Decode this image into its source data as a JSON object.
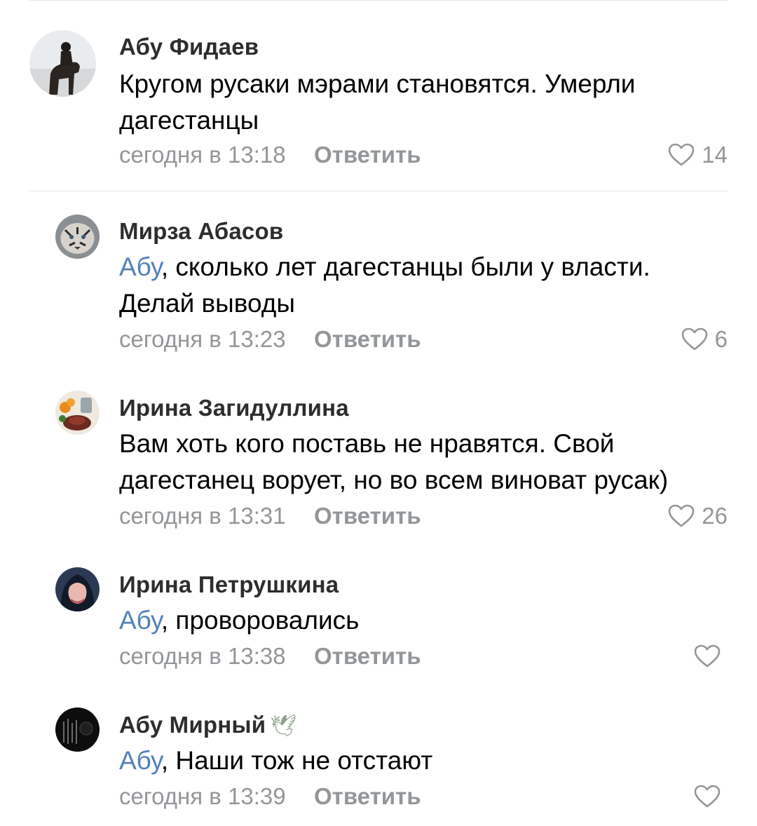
{
  "colors": {
    "background": "#ffffff",
    "divider": "#e3e5e8",
    "author": "#2c2d2e",
    "meta": "#939699",
    "mention": "#5181b8"
  },
  "reply_label": "Ответить",
  "comments": [
    {
      "author": "Абу Фидаев",
      "mention": "",
      "text": "Кругом русаки мэрами становятся.  Умерли дагестанцы",
      "time": "сегодня в 13:18",
      "likes": "14",
      "avatar_icon": "rider-on-horse-avatar"
    },
    {
      "author": "Мирза Абасов",
      "mention": "Абу",
      "text": ", сколько лет дагестанцы были у власти. Делай выводы",
      "time": "сегодня в 13:23",
      "likes": "6",
      "avatar_icon": "tiger-avatar"
    },
    {
      "author": "Ирина Загидуллина",
      "mention": "",
      "text": "Вам хоть кого поставь не нравятся. Свой дагестанец ворует, но во всем виноват русак)",
      "time": "сегодня в 13:31",
      "likes": "26",
      "avatar_icon": "food-table-avatar"
    },
    {
      "author": "Ирина Петрушкина",
      "mention": "Абу",
      "text": ", проворовались",
      "time": "сегодня в 13:38",
      "likes": "",
      "avatar_icon": "woman-portrait-avatar"
    },
    {
      "author": "Абу Мирный",
      "author_emoji": "🕊",
      "mention": "Абу",
      "text": ", Наши тож не отстают",
      "time": "сегодня в 13:39",
      "likes": "",
      "avatar_icon": "dark-avatar"
    }
  ]
}
